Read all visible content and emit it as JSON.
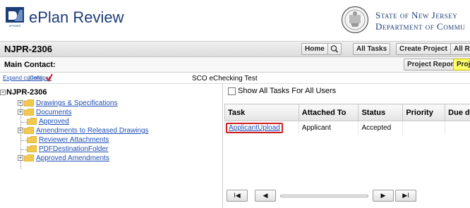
{
  "header": {
    "app_title": "ePlan Review",
    "logo_caption": "AFFAIRS",
    "state_line1": "State of New Jersey",
    "state_line2": "Department of Commu"
  },
  "project": {
    "id": "NJPR-2306",
    "buttons": {
      "home": "Home",
      "all_tasks": "All Tasks",
      "create_project": "Create Project",
      "all_reports": "All Re"
    }
  },
  "contact": {
    "label": "Main Contact:",
    "buttons": {
      "project_reports": "Project Reports",
      "projects": "Proje"
    }
  },
  "toolbar": {
    "expand_current": "Expand current",
    "separator": "|",
    "collapse": "Collapse",
    "panel_title": "SCO eChecking Test"
  },
  "tree": {
    "root": "NJPR-2306",
    "items": [
      {
        "label": "Drawings & Specifications",
        "expandable": true
      },
      {
        "label": "Documents",
        "expandable": true
      },
      {
        "label": "Approved",
        "expandable": false
      },
      {
        "label": "Amendments to Released Drawings",
        "expandable": true
      },
      {
        "label": "Reviewer Attachments",
        "expandable": false
      },
      {
        "label": "PDFDestinationFolder",
        "expandable": false
      },
      {
        "label": "Approved Amendments",
        "expandable": true
      }
    ]
  },
  "tasks": {
    "show_all_label": "Show All Tasks For All Users",
    "columns": [
      "Task",
      "Attached To",
      "Status",
      "Priority",
      "Due da"
    ],
    "rows": [
      {
        "task": "ApplicantUpload",
        "attached_to": "Applicant",
        "status": "Accepted",
        "priority": "",
        "due": ""
      }
    ]
  },
  "pager": {
    "first": "I◀",
    "prev": "◀",
    "next": "▶",
    "last": "▶I"
  },
  "colors": {
    "brand_blue": "#1c3d78",
    "link_blue": "#1f4fb5",
    "highlight_yellow": "#ffff66",
    "annotation_red": "#d21f1f"
  }
}
